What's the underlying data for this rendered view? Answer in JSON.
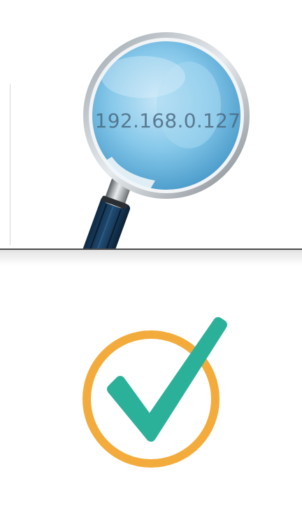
{
  "lookup": {
    "ip_address": "192.168.0.127"
  },
  "icons": {
    "top": "magnifying-glass-icon",
    "bottom": "checkmark-circle-icon"
  },
  "colors": {
    "lens_blue": "#7cc3e8",
    "ring_orange": "#f3ac3c",
    "check_teal": "#2bb19a"
  }
}
